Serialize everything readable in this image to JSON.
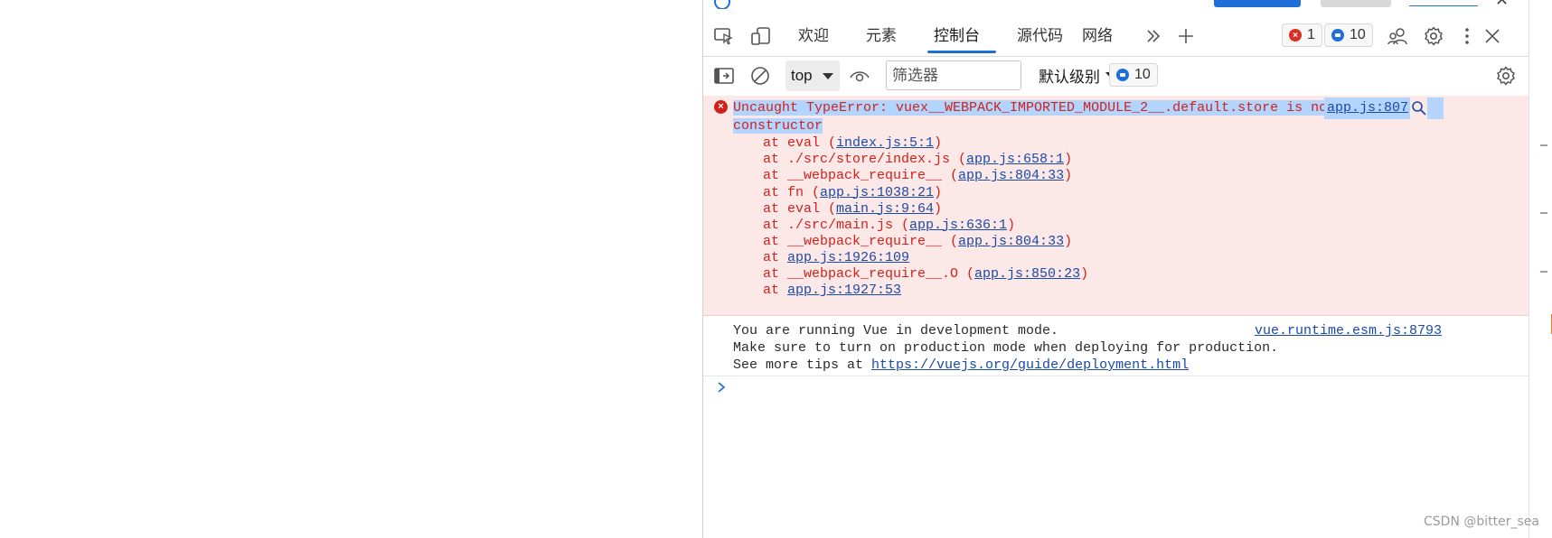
{
  "devtools": {
    "tabs": [
      {
        "label": "欢迎"
      },
      {
        "label": "元素"
      },
      {
        "label": "控制台"
      },
      {
        "label": "源代码"
      },
      {
        "label": "网络"
      }
    ],
    "badges": {
      "errors": "1",
      "messages": "10"
    },
    "icons": {
      "inspect": "inspect-element-icon",
      "device": "device-emulation-icon",
      "more_tabs": "chevron-double-right-icon",
      "add_tab": "plus-icon",
      "feedback": "people-icon",
      "settings": "gear-icon",
      "menu": "kebab-menu-icon",
      "close": "close-icon"
    }
  },
  "console_toolbar": {
    "context": "top",
    "filter_placeholder": "筛选器",
    "level": "默认级别",
    "message_count": "10"
  },
  "messages": {
    "error": {
      "text_line1": "Uncaught TypeError: vuex__WEBPACK_IMPORTED_MODULE_2__.default.store is not a",
      "text_line2": "constructor",
      "source": "app.js:807",
      "stack": [
        {
          "prefix": "at eval (",
          "link": "index.js:5:1",
          "suffix": ")"
        },
        {
          "prefix": "at ./src/store/index.js (",
          "link": "app.js:658:1",
          "suffix": ")"
        },
        {
          "prefix": "at __webpack_require__ (",
          "link": "app.js:804:33",
          "suffix": ")"
        },
        {
          "prefix": "at fn (",
          "link": "app.js:1038:21",
          "suffix": ")"
        },
        {
          "prefix": "at eval (",
          "link": "main.js:9:64",
          "suffix": ")"
        },
        {
          "prefix": "at ./src/main.js (",
          "link": "app.js:636:1",
          "suffix": ")"
        },
        {
          "prefix": "at __webpack_require__ (",
          "link": "app.js:804:33",
          "suffix": ")"
        },
        {
          "prefix": "at ",
          "link": "app.js:1926:109",
          "suffix": ""
        },
        {
          "prefix": "at __webpack_require__.O (",
          "link": "app.js:850:23",
          "suffix": ")"
        },
        {
          "prefix": "at ",
          "link": "app.js:1927:53",
          "suffix": ""
        }
      ]
    },
    "log": {
      "line1": "You are running Vue in development mode.",
      "line2": "Make sure to turn on production mode when deploying for production.",
      "line3_prefix": "See more tips at ",
      "line3_link": "https://vuejs.org/guide/deployment.html",
      "source": "vue.runtime.esm.js:8793"
    }
  },
  "watermark": "CSDN @bitter_sea",
  "colors": {
    "accent": "#1f6fd8",
    "error_text": "#d1211b",
    "error_bg": "#fde8e8",
    "link": "#1a4aa8",
    "selection": "#b3d4fc"
  }
}
